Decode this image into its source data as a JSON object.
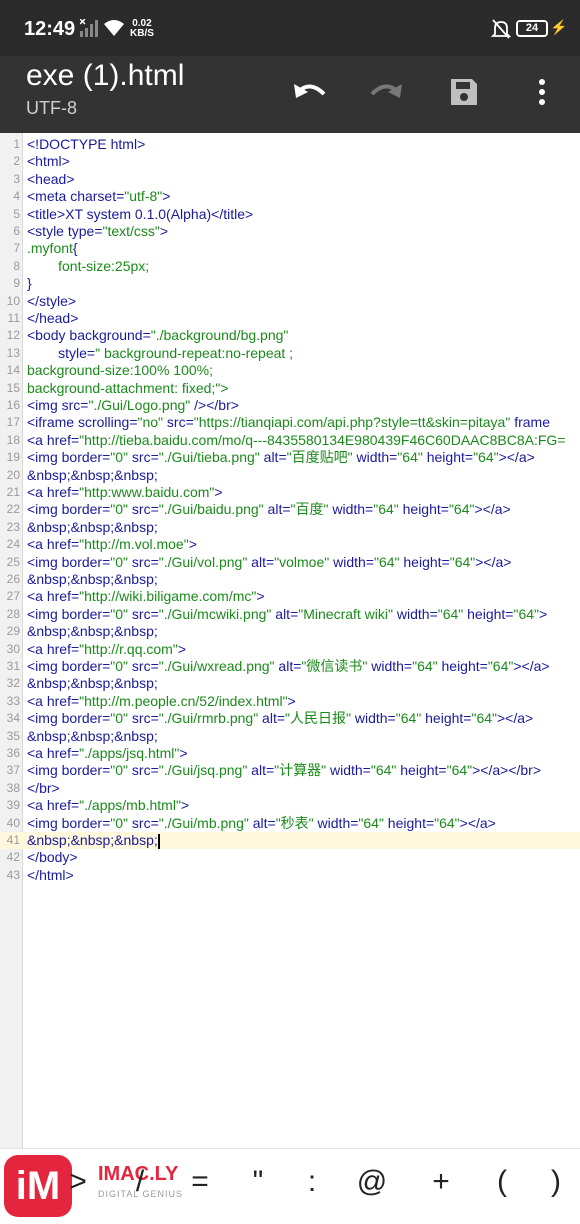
{
  "status_bar": {
    "time": "12:49",
    "speed_value": "0.02",
    "speed_unit": "KB/S",
    "battery": "24"
  },
  "app_bar": {
    "title": "exe (1).html",
    "encoding": "UTF-8",
    "icons": [
      "undo-icon",
      "redo-icon",
      "save-icon",
      "more-vert-icon"
    ]
  },
  "editor": {
    "active_line": 41,
    "lines": [
      {
        "n": "1",
        "t": "<!DOCTYPE html>"
      },
      {
        "n": "2",
        "t": "<html>"
      },
      {
        "n": "3",
        "t": "<head>"
      },
      {
        "n": "4",
        "t": "<meta charset=\"utf-8\">"
      },
      {
        "n": "5",
        "t": "<title>XT system 0.1.0(Alpha)</title>"
      },
      {
        "n": "6",
        "t": "<style type=\"text/css\">"
      },
      {
        "n": "7",
        "t": ".myfont{"
      },
      {
        "n": "8",
        "t": "        font-size:25px;"
      },
      {
        "n": "9",
        "t": "}"
      },
      {
        "n": "10",
        "t": "</style>"
      },
      {
        "n": "11",
        "t": "</head>"
      },
      {
        "n": "12",
        "t": "<body background=\"./background/bg.png\""
      },
      {
        "n": "13",
        "t": "        style=\" background-repeat:no-repeat ;"
      },
      {
        "n": "14",
        "t": "background-size:100% 100%;"
      },
      {
        "n": "15",
        "t": "background-attachment: fixed;\">"
      },
      {
        "n": "16",
        "t": "<img src=\"./Gui/Logo.png\" /></br>"
      },
      {
        "n": "17",
        "t": "<iframe scrolling=\"no\" src=\"https://tianqiapi.com/api.php?style=tt&skin=pitaya\" frame"
      },
      {
        "n": "18",
        "t": "<a href=\"http://tieba.baidu.com/mo/q---8435580134E980439F46C60DAAC8BC8A:FG="
      },
      {
        "n": "19",
        "t": "<img border=\"0\" src=\"./Gui/tieba.png\" alt=\"百度贴吧\" width=\"64\" height=\"64\"></a>"
      },
      {
        "n": "20",
        "t": "&nbsp;&nbsp;&nbsp;"
      },
      {
        "n": "21",
        "t": "<a href=\"http:www.baidu.com\">"
      },
      {
        "n": "22",
        "t": "<img border=\"0\" src=\"./Gui/baidu.png\" alt=\"百度\" width=\"64\" height=\"64\"></a>"
      },
      {
        "n": "23",
        "t": "&nbsp;&nbsp;&nbsp;"
      },
      {
        "n": "24",
        "t": "<a href=\"http://m.vol.moe\">"
      },
      {
        "n": "25",
        "t": "<img border=\"0\" src=\"./Gui/vol.png\" alt=\"volmoe\" width=\"64\" height=\"64\"></a>"
      },
      {
        "n": "26",
        "t": "&nbsp;&nbsp;&nbsp;"
      },
      {
        "n": "27",
        "t": "<a href=\"http://wiki.biligame.com/mc\">"
      },
      {
        "n": "28",
        "t": "<img border=\"0\" src=\"./Gui/mcwiki.png\" alt=\"Minecraft wiki\" width=\"64\" height=\"64\">"
      },
      {
        "n": "29",
        "t": "&nbsp;&nbsp;&nbsp;"
      },
      {
        "n": "30",
        "t": "<a href=\"http://r.qq.com\">"
      },
      {
        "n": "31",
        "t": "<img border=\"0\" src=\"./Gui/wxread.png\" alt=\"微信读书\" width=\"64\" height=\"64\"></a>"
      },
      {
        "n": "32",
        "t": "&nbsp;&nbsp;&nbsp;"
      },
      {
        "n": "33",
        "t": "<a href=\"http://m.people.cn/52/index.html\">"
      },
      {
        "n": "34",
        "t": "<img border=\"0\" src=\"./Gui/rmrb.png\" alt=\"人民日报\" width=\"64\" height=\"64\"></a>"
      },
      {
        "n": "35",
        "t": "&nbsp;&nbsp;&nbsp;"
      },
      {
        "n": "36",
        "t": "<a href=\"./apps/jsq.html\">"
      },
      {
        "n": "37",
        "t": "<img border=\"0\" src=\"./Gui/jsq.png\" alt=\"计算器\" width=\"64\" height=\"64\"></a></br>"
      },
      {
        "n": "38",
        "t": "</br>"
      },
      {
        "n": "39",
        "t": "<a href=\"./apps/mb.html\">"
      },
      {
        "n": "40",
        "t": "<img border=\"0\" src=\"./Gui/mb.png\" alt=\"秒表\" width=\"64\" height=\"64\"></a>"
      },
      {
        "n": "41",
        "t": "&nbsp;&nbsp;&nbsp;"
      },
      {
        "n": "42",
        "t": "</body>"
      },
      {
        "n": "43",
        "t": "</html>"
      }
    ]
  },
  "symbol_bar": {
    "logo_mark": "iM",
    "logo_text": "IMAC.LY",
    "logo_sub": "DIGITAL GENIUS",
    "symbols": [
      ">",
      "/",
      "=",
      "\"",
      ":",
      "@",
      "+",
      "(",
      ")"
    ]
  },
  "colors": {
    "tag": "#1a1a9c",
    "attr_value": "#1b8a1b",
    "css": "#1b8a1b",
    "entity": "#1a1a9c",
    "active_line": "#fff8dc"
  }
}
